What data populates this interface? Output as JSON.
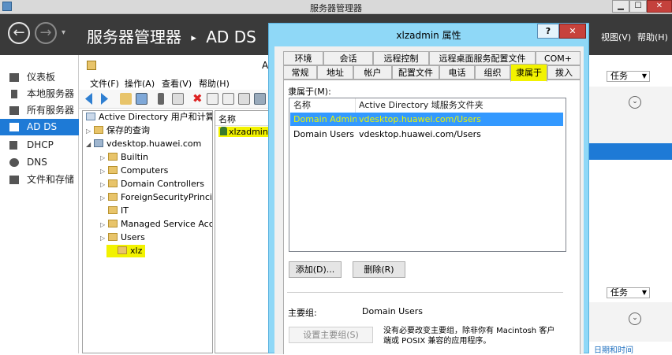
{
  "window": {
    "title": "服务器管理器",
    "min": "▁",
    "max": "☐",
    "close": "✕"
  },
  "header": {
    "breadcrumb_app": "服务器管理器",
    "breadcrumb_sep": "▸",
    "breadcrumb_section": "AD DS",
    "menu_view": "视图(V)",
    "menu_help": "帮助(H)"
  },
  "leftnav": {
    "items": [
      {
        "label": "仪表板",
        "icon": "dashboard-icon"
      },
      {
        "label": "本地服务器",
        "icon": "server-icon"
      },
      {
        "label": "所有服务器",
        "icon": "servers-icon"
      },
      {
        "label": "AD DS",
        "icon": "adds-icon"
      },
      {
        "label": "DHCP",
        "icon": "dhcp-icon"
      },
      {
        "label": "DNS",
        "icon": "dns-icon"
      },
      {
        "label": "文件和存储",
        "icon": "storage-icon"
      }
    ]
  },
  "mmc": {
    "title_fragment": "A",
    "menu": [
      "文件(F)",
      "操作(A)",
      "查看(V)",
      "帮助(H)"
    ],
    "tree": [
      {
        "label": "Active Directory 用户和计算机",
        "indent": 0,
        "exp": ""
      },
      {
        "label": "保存的查询",
        "indent": 1,
        "exp": "▷"
      },
      {
        "label": "vdesktop.huawei.com",
        "indent": 1,
        "exp": "◢"
      },
      {
        "label": "Builtin",
        "indent": 2,
        "exp": "▷"
      },
      {
        "label": "Computers",
        "indent": 2,
        "exp": "▷"
      },
      {
        "label": "Domain Controllers",
        "indent": 2,
        "exp": "▷"
      },
      {
        "label": "ForeignSecurityPrincipa",
        "indent": 2,
        "exp": "▷"
      },
      {
        "label": "IT",
        "indent": 2,
        "exp": ""
      },
      {
        "label": "Managed Service Acco",
        "indent": 2,
        "exp": "▷"
      },
      {
        "label": "Users",
        "indent": 2,
        "exp": "▷"
      },
      {
        "label": "xlz",
        "indent": 2,
        "exp": ""
      }
    ],
    "list_header": "名称",
    "list_item": "xlzadmin"
  },
  "dialog": {
    "title": "xlzadmin 属性",
    "help": "?",
    "close": "✕",
    "tabs_row1": [
      "环境",
      "会话",
      "远程控制",
      "远程桌面服务配置文件",
      "COM+"
    ],
    "tabs_row2": [
      "常规",
      "地址",
      "帐户",
      "配置文件",
      "电话",
      "组织",
      "隶属于",
      "拨入"
    ],
    "active_tab": "隶属于",
    "member_of_label": "隶属于(M):",
    "columns": [
      "名称",
      "Active Directory 域服务文件夹"
    ],
    "rows": [
      {
        "name": "Domain Admins",
        "folder": "vdesktop.huawei.com/Users",
        "selected": true
      },
      {
        "name": "Domain Users",
        "folder": "vdesktop.huawei.com/Users",
        "selected": false
      }
    ],
    "add_button": "添加(D)...",
    "remove_button": "删除(R)",
    "primary_group_label": "主要组:",
    "primary_group_value": "Domain Users",
    "set_primary_button": "设置主要组(S)",
    "primary_note_line1": "没有必要改变主要组，除非你有 Macintosh 客户",
    "primary_note_line2": "端或 POSIX 兼容的应用程序。"
  },
  "rightpane": {
    "tasks1": "任务",
    "tasks2": "任务",
    "date_link": "日期和时间"
  },
  "colors": {
    "header_bg": "#3a3a3a",
    "nav_selected": "#1e7ad6",
    "dialog_frame": "#8fd8f7",
    "highlight": "#f2f200",
    "selection": "#3399ff"
  }
}
